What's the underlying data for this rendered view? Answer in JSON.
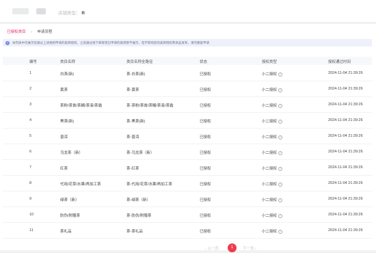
{
  "header": {
    "shop_type_label": "店铺类型：",
    "shop_type_value": "R"
  },
  "breadcrumb": {
    "parent": "已授权类目",
    "separator": "›",
    "current": "申请流程"
  },
  "notice": {
    "text": "本列表中仅展示您通过上述规则申请的类目授权。之前通过线下邮寄或已申请的类目暂不展示，但不影响您的类目授权和商品发布，请勿重复申请"
  },
  "table": {
    "headers": [
      "编号",
      "类目名称",
      "类目名称全路径",
      "状态",
      "授权类型",
      "授权通过时间"
    ],
    "rows": [
      {
        "no": "1",
        "name": "白茶(新)",
        "path": "茶-白茶(新)",
        "status": "已授权",
        "type": "小二授权",
        "time": "2024-11-04 21:39:26"
      },
      {
        "no": "2",
        "name": "黄茶",
        "path": "茶-黄茶",
        "status": "已授权",
        "type": "小二授权",
        "time": "2024-11-04 21:39:26"
      },
      {
        "no": "3",
        "name": "茶粉/茶膏/茶糊/茶液/茶霜",
        "path": "茶-茶粉/茶膏/茶糊/茶液/茶霜",
        "status": "已授权",
        "type": "小二授权",
        "time": "2024-11-04 21:39:26"
      },
      {
        "no": "4",
        "name": "黑茶(新)",
        "path": "茶-黑茶(新)",
        "status": "已授权",
        "type": "小二授权",
        "time": "2024-11-04 21:39:26"
      },
      {
        "no": "5",
        "name": "普洱",
        "path": "茶-普洱",
        "status": "已授权",
        "type": "小二授权",
        "time": "2024-11-04 21:39:26"
      },
      {
        "no": "6",
        "name": "乌龙茶（新）",
        "path": "茶-乌龙茶（新）",
        "status": "已授权",
        "type": "小二授权",
        "time": "2024-11-04 21:39:26"
      },
      {
        "no": "7",
        "name": "红茶",
        "path": "茶-红茶",
        "status": "已授权",
        "type": "小二授权",
        "time": "2024-11-04 21:39:26"
      },
      {
        "no": "8",
        "name": "代用/花草/水果/再加工茶",
        "path": "茶-代用/花草/水果/再加工茶",
        "status": "已授权",
        "type": "小二授权",
        "time": "2024-11-04 21:39:26"
      },
      {
        "no": "9",
        "name": "绿茶（新）",
        "path": "茶-绿茶（新）",
        "status": "已授权",
        "type": "小二授权",
        "time": "2024-11-04 21:39:26"
      },
      {
        "no": "10",
        "name": "防伪/附赠茶",
        "path": "茶-防伪/附赠茶",
        "status": "已授权",
        "type": "小二授权",
        "time": "2024-11-04 21:39:26"
      },
      {
        "no": "11",
        "name": "茶礼品",
        "path": "茶-茶礼品",
        "status": "已授权",
        "type": "小二授权",
        "time": "2024-11-04 21:39:26"
      }
    ]
  },
  "pagination": {
    "prev": "‹ 上一页",
    "current": "1",
    "next": "下一页 ›"
  },
  "colors": {
    "accent": "#e8265a",
    "pager_active": "#ef3b4f",
    "notice_bg": "#eef1fb",
    "info_icon": "#6a8be6"
  }
}
